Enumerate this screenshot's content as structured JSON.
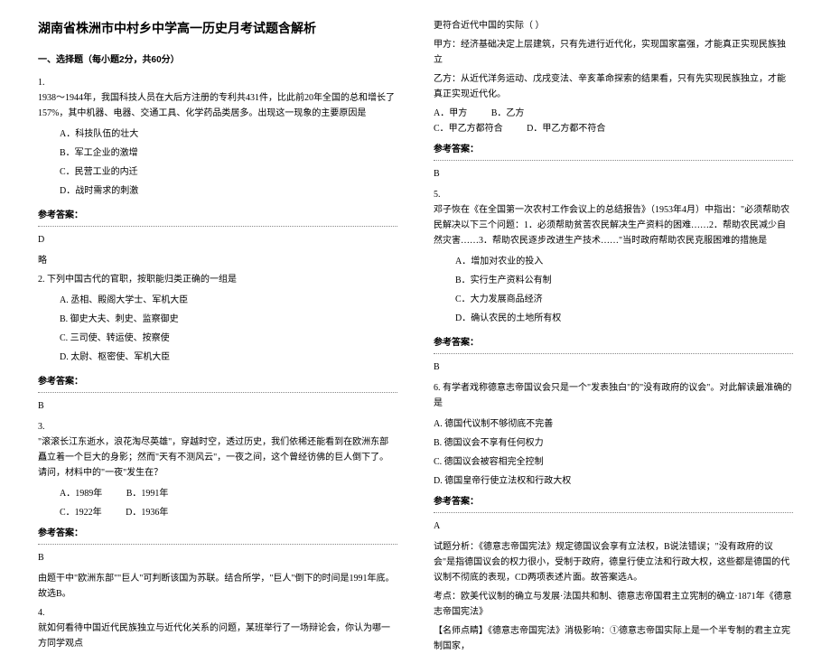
{
  "title": "湖南省株洲市中村乡中学高一历史月考试题含解析",
  "section1": "一、选择题（每小题2分，共60分）",
  "q1": {
    "num": "1.",
    "text": "1938～1944年，我国科技人员在大后方注册的专利共431件，比此前20年全国的总和增长了157%，其中机器、电器、交通工具、化学药品类居多。出现这一现象的主要原因是",
    "a": "A．科技队伍的壮大",
    "b": "B．军工企业的激增",
    "c": "C．民营工业的内迁",
    "d": "D．战时需求的刺激"
  },
  "ref": "参考答案：",
  "q1ans": "D",
  "q1note": "略",
  "q2": {
    "num": "2. 下列中国古代的官职，按职能归类正确的一组是",
    "a": "A. 丞相、殿阁大学士、军机大臣",
    "b": "B. 御史大夫、刺史、监察御史",
    "c": "C. 三司使、转运使、按察使",
    "d": "D. 太尉、枢密使、军机大臣"
  },
  "q2ans": "B",
  "q3": {
    "num": "3.",
    "text": "\"滚滚长江东逝水，浪花淘尽英雄\"，穿越时空，透过历史，我们依稀还能看到在欧洲东部矗立着一个巨大的身影；然而\"天有不测风云\"，一夜之间，这个曾经彷佛的巨人倒下了。请问，材料中的\"一夜\"发生在？",
    "a": "A．1989年",
    "b": "B．1991年",
    "c": "C．1922年",
    "d": "D．1936年"
  },
  "q3ans": "B",
  "q3expl": "由题干中\"欧洲东部\"\"巨人\"可判断该国为苏联。结合所学，\"巨人\"倒下的时间是1991年底。故选B。",
  "q4": {
    "num": "4.",
    "text": "就如何看待中国近代民族独立与近代化关系的问题，某班举行了一场辩论会，你认为哪一方同学观点",
    "cont": "更符合近代中国的实际（    ）",
    "jia": "甲方：经济基础决定上层建筑，只有先进行近代化，实现国家富强，才能真正实现民族独立",
    "yi": "乙方：从近代洋务运动、戊戌变法、辛亥革命探索的结果看，只有先实现民族独立，才能真正实现近代化。",
    "a": "A．甲方",
    "b": "B．乙方",
    "c": "C．甲乙方都符合",
    "d": "D．甲乙方都不符合"
  },
  "q4ans": "B",
  "q5": {
    "num": "5.",
    "text": "邓子恢在《在全国第一次农村工作会议上的总结报告》（1953年4月）中指出：\"必须帮助农民解决以下三个问题：1．必须帮助贫苦农民解决生产资料的困难……2．帮助农民减少自然灾害……3．帮助农民逐步改进生产技术……\"当时政府帮助农民克服困难的措施是",
    "a": "A．增加对农业的投入",
    "b": "B．实行生产资料公有制",
    "c": "C．大力发展商品经济",
    "d": "D．确认农民的土地所有权"
  },
  "q5ans": "B",
  "q6": {
    "num": "6. 有学者戏称德意志帝国议会只是一个\"发表独白\"的\"没有政府的议会\"。对此解读最准确的是",
    "a": "A. 德国代议制不够彻底不完善",
    "b": "B. 德国议会不享有任何权力",
    "c": "C. 德国议会被容相完全控制",
    "d": "D. 德国皇帝行使立法权和行政大权"
  },
  "q6ans": "A",
  "q6expl1": "试题分析：《德意志帝国宪法》规定德国议会享有立法权，B说法错误；\"没有政府的议会\"是指德国议会的权力很小，受制于政府，德皇行使立法和行政大权，这些都是德国的代议制不彻底的表现，CD两项表述片面。故答案选A。",
  "q6expl2": "考点：欧美代议制的确立与发展·法国共和制、德意志帝国君主立宪制的确立·1871年《德意志帝国宪法》",
  "q6expl3": "【名师点睛】《德意志帝国宪法》消极影响：①德意志帝国实际上是一个半专制的君主立宪制国家，"
}
